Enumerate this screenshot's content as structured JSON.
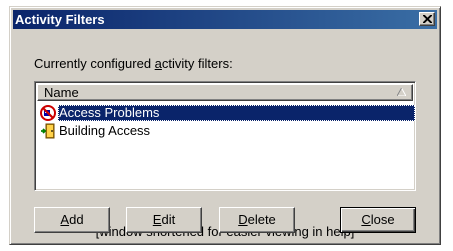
{
  "window": {
    "title": "Activity Filters"
  },
  "label": {
    "prefix": "Currently configured ",
    "accel": "a",
    "suffix": "ctivity filters:"
  },
  "list": {
    "column_header": "Name",
    "items": [
      {
        "label": "Access Problems",
        "icon": "no-entry-icon",
        "selected": true
      },
      {
        "label": "Building Access",
        "icon": "door-icon",
        "selected": false
      }
    ],
    "note": "[window shortened for easier viewing in help]"
  },
  "buttons": {
    "add": {
      "accel": "A",
      "rest": "dd"
    },
    "edit": {
      "accel": "E",
      "rest": "dit"
    },
    "delete": {
      "accel": "D",
      "rest": "elete"
    },
    "close": {
      "accel": "C",
      "rest": "lose"
    }
  },
  "colors": {
    "titlebar_start": "#0a246a",
    "titlebar_end": "#3a6ea5",
    "selection": "#0a246a",
    "face": "#d4d0c8"
  }
}
